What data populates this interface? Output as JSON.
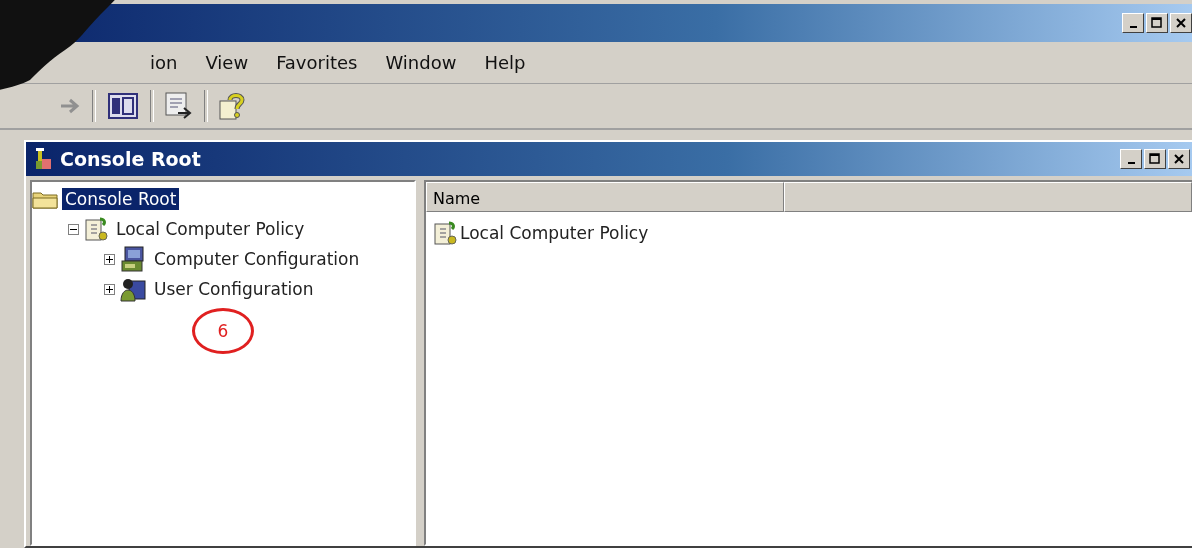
{
  "menu": [
    {
      "label": "ion"
    },
    {
      "label": "View"
    },
    {
      "label": "Favorites"
    },
    {
      "label": "Window"
    },
    {
      "label": "Help"
    }
  ],
  "console": {
    "title": "Console Root",
    "tree": [
      {
        "label": "Console Root",
        "selected": true,
        "children": [
          {
            "label": "Local Computer Policy",
            "selected": false,
            "expanded": true,
            "children": [
              {
                "label": "Computer Configuration",
                "selected": false,
                "expanded": false
              },
              {
                "label": "User Configuration",
                "selected": false,
                "expanded": false
              }
            ]
          }
        ]
      }
    ],
    "columns": [
      {
        "label": "Name"
      }
    ],
    "rows": [
      {
        "name": "Local Computer Policy"
      }
    ]
  },
  "annotation": {
    "label": "6"
  }
}
